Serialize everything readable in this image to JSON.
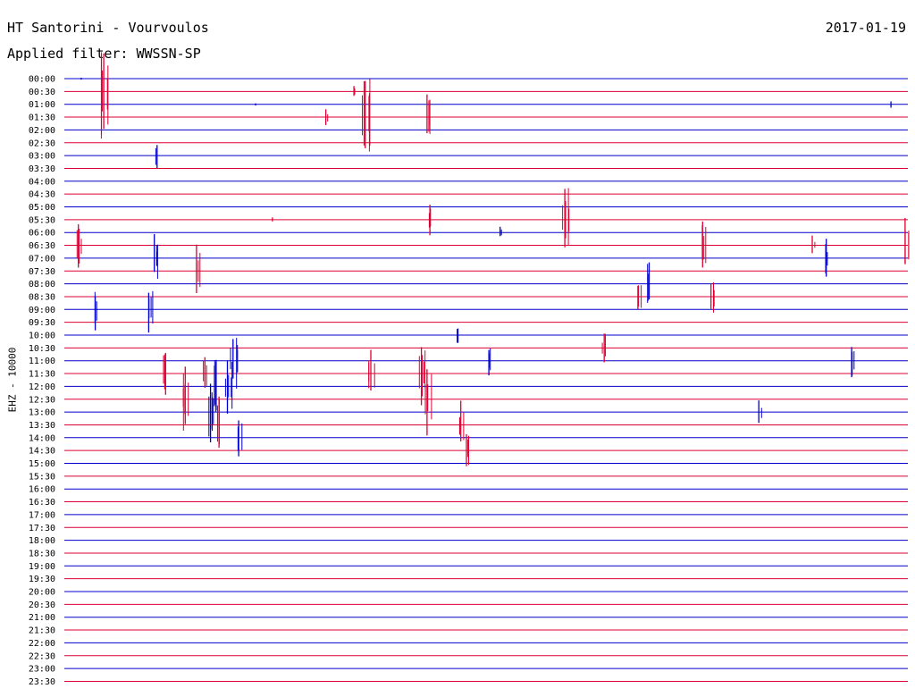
{
  "header": {
    "title": "HT Santorini - Vourvoulos",
    "date": "2017-01-19",
    "filter": "Applied filter: WWSSN-SP",
    "channel": "EHZ - 10000"
  },
  "colors": {
    "blue": "#0000cc",
    "red": "#dd0033"
  },
  "chart_data": {
    "type": "line",
    "title": "HT Santorini - Vourvoulos",
    "ylabel": "EHZ - 10000",
    "rows": [
      "00:00",
      "00:30",
      "01:00",
      "01:30",
      "02:00",
      "02:30",
      "03:00",
      "03:30",
      "04:00",
      "04:30",
      "05:00",
      "05:30",
      "06:00",
      "06:30",
      "07:00",
      "07:30",
      "08:00",
      "08:30",
      "09:00",
      "09:30",
      "10:00",
      "10:30",
      "11:00",
      "11:30",
      "12:00",
      "12:30",
      "13:00",
      "13:30",
      "14:00",
      "14:30",
      "15:00",
      "15:30",
      "16:00",
      "16:30",
      "17:00",
      "17:30",
      "18:00",
      "18:30",
      "19:00",
      "19:30",
      "20:00",
      "20:30",
      "21:00",
      "21:30",
      "22:00",
      "22:30",
      "23:00",
      "23:30"
    ],
    "trace_colors": [
      "blue",
      "red"
    ],
    "minutes_per_row": 30,
    "events": [
      {
        "row": 0,
        "minute": 0.6,
        "amp": 0.1
      },
      {
        "row": 1,
        "minute": 1.4,
        "amp": 4.3
      },
      {
        "row": 1,
        "minute": 10.3,
        "amp": 0.6
      },
      {
        "row": 2,
        "minute": 6.8,
        "amp": 0.1
      },
      {
        "row": 2,
        "minute": 29.4,
        "amp": 0.3
      },
      {
        "row": 3,
        "minute": 9.3,
        "amp": 0.8
      },
      {
        "row": 3,
        "minute": 10.7,
        "amp": 3.6
      },
      {
        "row": 3,
        "minute": 12.9,
        "amp": 2.2
      },
      {
        "row": 6,
        "minute": 3.3,
        "amp": 1.0
      },
      {
        "row": 11,
        "minute": 13.0,
        "amp": 1.4
      },
      {
        "row": 11,
        "minute": 17.8,
        "amp": 2.8
      },
      {
        "row": 11,
        "minute": 7.4,
        "amp": 0.2
      },
      {
        "row": 12,
        "minute": 15.5,
        "amp": 0.5
      },
      {
        "row": 13,
        "minute": 0.5,
        "amp": 1.8
      },
      {
        "row": 13,
        "minute": 22.7,
        "amp": 2.0
      },
      {
        "row": 13,
        "minute": 26.6,
        "amp": 0.8
      },
      {
        "row": 13,
        "minute": 29.9,
        "amp": 2.2
      },
      {
        "row": 14,
        "minute": 3.2,
        "amp": 1.9
      },
      {
        "row": 14,
        "minute": 27.1,
        "amp": 1.5
      },
      {
        "row": 15,
        "minute": 4.7,
        "amp": 2.0
      },
      {
        "row": 16,
        "minute": 20.8,
        "amp": 1.6
      },
      {
        "row": 17,
        "minute": 20.4,
        "amp": 1.5
      },
      {
        "row": 17,
        "minute": 23.0,
        "amp": 1.7
      },
      {
        "row": 18,
        "minute": 1.1,
        "amp": 1.7
      },
      {
        "row": 18,
        "minute": 3.0,
        "amp": 2.1
      },
      {
        "row": 20,
        "minute": 14.0,
        "amp": 0.8
      },
      {
        "row": 21,
        "minute": 19.2,
        "amp": 1.7
      },
      {
        "row": 22,
        "minute": 6.0,
        "amp": 2.5
      },
      {
        "row": 22,
        "minute": 15.1,
        "amp": 1.2
      },
      {
        "row": 22,
        "minute": 28.0,
        "amp": 1.5
      },
      {
        "row": 23,
        "minute": 3.6,
        "amp": 2.2
      },
      {
        "row": 23,
        "minute": 5.0,
        "amp": 1.7
      },
      {
        "row": 23,
        "minute": 10.9,
        "amp": 2.4
      },
      {
        "row": 23,
        "minute": 12.7,
        "amp": 2.6
      },
      {
        "row": 24,
        "minute": 5.8,
        "amp": 2.5
      },
      {
        "row": 24,
        "minute": 5.4,
        "amp": 2.5
      },
      {
        "row": 25,
        "minute": 4.3,
        "amp": 3.0
      },
      {
        "row": 25,
        "minute": 12.9,
        "amp": 2.7
      },
      {
        "row": 26,
        "minute": 5.2,
        "amp": 2.5
      },
      {
        "row": 26,
        "minute": 24.7,
        "amp": 1.0
      },
      {
        "row": 27,
        "minute": 5.5,
        "amp": 2.4
      },
      {
        "row": 27,
        "minute": 14.1,
        "amp": 2.0
      },
      {
        "row": 28,
        "minute": 6.2,
        "amp": 1.4
      },
      {
        "row": 29,
        "minute": 14.3,
        "amp": 1.3
      }
    ]
  }
}
